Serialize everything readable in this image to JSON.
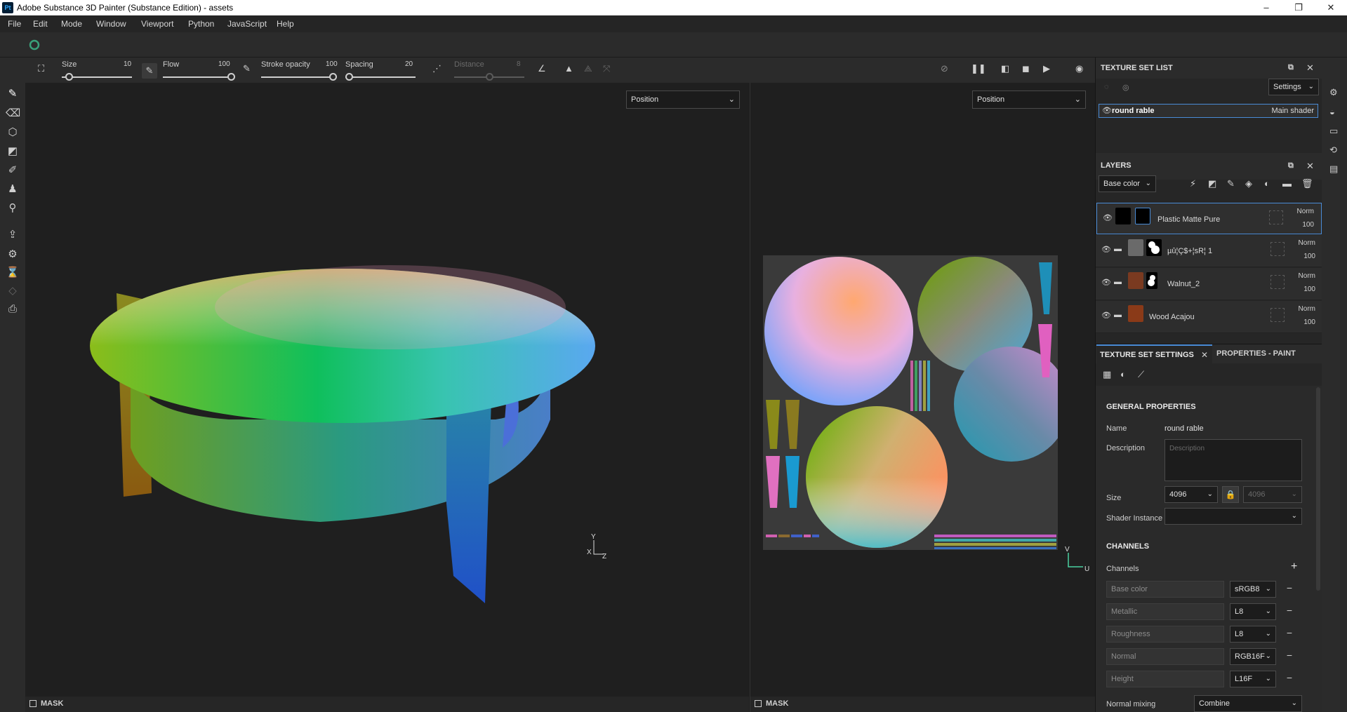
{
  "window": {
    "app_logo": "Pt",
    "title": "Adobe Substance 3D Painter (Substance Edition) - assets",
    "controls": [
      "–",
      "❐",
      "✕"
    ]
  },
  "menu": [
    "File",
    "Edit",
    "Mode",
    "Window",
    "Viewport",
    "Python",
    "JavaScript",
    "Help"
  ],
  "tool_options": {
    "size": {
      "label": "Size",
      "value": "10",
      "level": 0.1
    },
    "flow": {
      "label": "Flow",
      "value": "100",
      "level": 1.0
    },
    "stroke_opacity": {
      "label": "Stroke opacity",
      "value": "100",
      "level": 1.0
    },
    "spacing": {
      "label": "Spacing",
      "value": "20",
      "level": 0.05
    },
    "distance": {
      "label": "Distance",
      "value": "8",
      "level": 0.5
    }
  },
  "viewport_3d": {
    "channel_select": "Position",
    "mask_label": "MASK",
    "axis_y": "Y",
    "axis_x": "X",
    "axis_z": "Z"
  },
  "viewport_2d": {
    "channel_select": "Position",
    "mask_label": "MASK",
    "axis_v": "V",
    "axis_u": "U"
  },
  "texture_set_list": {
    "title": "TEXTURE SET LIST",
    "settings_label": "Settings",
    "item_name": "round rable",
    "item_shader": "Main shader"
  },
  "layers": {
    "title": "LAYERS",
    "channel_select": "Base color",
    "items": [
      {
        "name": "Plastic Matte Pure",
        "blend": "Norm",
        "opacity": "100"
      },
      {
        "name": "µû¦Ç$+¦sR¦ 1",
        "blend": "Norm",
        "opacity": "100"
      },
      {
        "name": "Walnut_2",
        "blend": "Norm",
        "opacity": "100"
      },
      {
        "name": "Wood Acajou",
        "blend": "Norm",
        "opacity": "100"
      }
    ]
  },
  "tabs": {
    "texture_set_settings": "TEXTURE SET SETTINGS",
    "properties_paint": "PROPERTIES - PAINT"
  },
  "general": {
    "section_title": "GENERAL PROPERTIES",
    "name_label": "Name",
    "name_value": "round rable",
    "description_label": "Description",
    "description_placeholder": "Description",
    "size_label": "Size",
    "size_value": "4096",
    "size_value2": "4096",
    "shader_label": "Shader Instance",
    "shader_value": ""
  },
  "channels": {
    "section_title": "CHANNELS",
    "channels_label": "Channels",
    "items": [
      {
        "name": "Base color",
        "format": "sRGB8"
      },
      {
        "name": "Metallic",
        "format": "L8"
      },
      {
        "name": "Roughness",
        "format": "L8"
      },
      {
        "name": "Normal",
        "format": "RGB16F"
      },
      {
        "name": "Height",
        "format": "L16F"
      }
    ],
    "normal_mixing_label": "Normal mixing",
    "normal_mixing_value": "Combine"
  }
}
